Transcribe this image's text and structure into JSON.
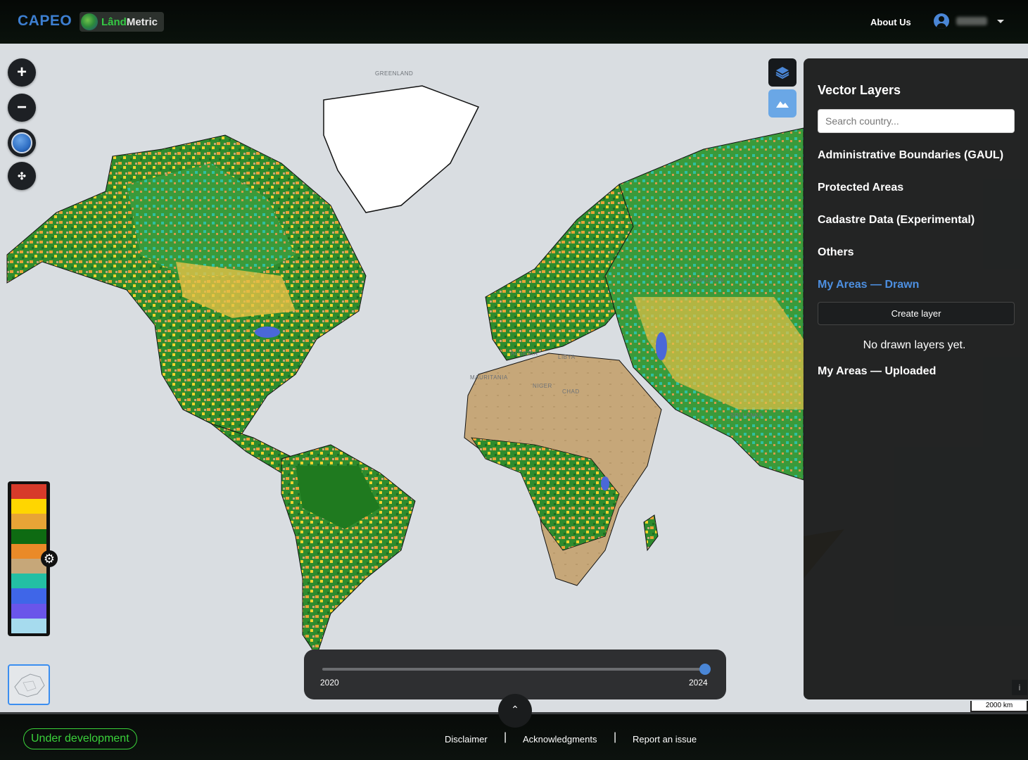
{
  "header": {
    "brand": "CAPEO",
    "logo_text_a": "Lând",
    "logo_text_b": "Metric",
    "about_label": "About Us"
  },
  "map": {
    "labels": {
      "greenland": "GREENLAND",
      "algeria": "ALGERIA",
      "libya": "LIBYA",
      "niger": "NIGER",
      "chad": "CHAD",
      "mauritania": "MAURITANIA",
      "kazakhstan": "KAZAKHSTAN",
      "sri_lanka": "SRI LANKA"
    },
    "zoom_in": "+",
    "zoom_out": "−",
    "pan_icon": "✣",
    "scale": "2000 km"
  },
  "legend": {
    "colors": [
      "#d73a2a",
      "#ffd600",
      "#e8a436",
      "#0e6b12",
      "#ea8a28",
      "#c6a779",
      "#23bfa4",
      "#3f66e8",
      "#6a55ea",
      "#a6dbee"
    ]
  },
  "panel": {
    "title": "Vector Layers",
    "search_placeholder": "Search country...",
    "sections": {
      "admin": "Administrative Boundaries (GAUL)",
      "protected": "Protected Areas",
      "cadastre": "Cadastre Data (Experimental)",
      "others": "Others",
      "drawn": "My Areas — Drawn",
      "uploaded": "My Areas — Uploaded"
    },
    "create_label": "Create layer",
    "empty_text": "No drawn layers yet."
  },
  "timeline": {
    "start": "2020",
    "end": "2024",
    "value": "2024"
  },
  "footer": {
    "badge": "Under development",
    "links": {
      "disclaimer": "Disclaimer",
      "acknowledgments": "Acknowledgments",
      "report": "Report an issue"
    },
    "separator": "|"
  }
}
